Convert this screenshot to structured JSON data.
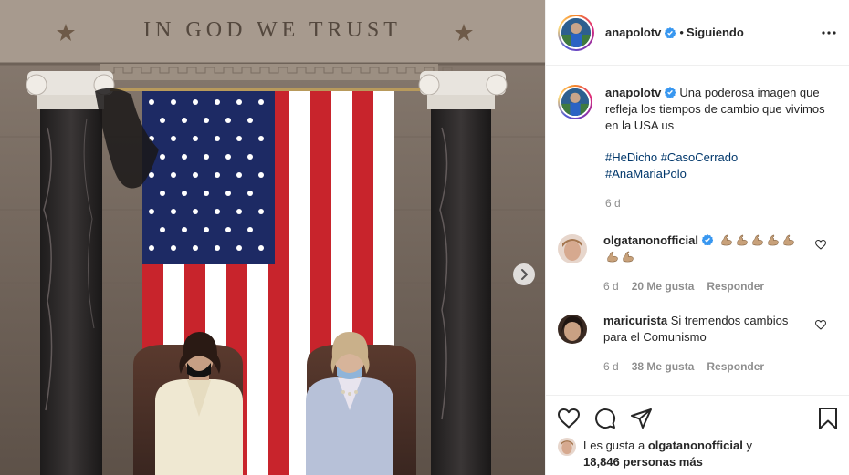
{
  "photo": {
    "inscription": "IN GOD WE TRUST",
    "next_icon": "chevron-right-icon"
  },
  "header": {
    "username": "anapolotv",
    "separator": "•",
    "follow_status": "Siguiendo",
    "more_icon": "more-horizontal-icon"
  },
  "caption": {
    "username": "anapolotv",
    "text": "Una poderosa imagen que refleja los tiempos de cambio que vivimos en la USA us",
    "hashtags_line1": "#HeDicho #CasoCerrado",
    "hashtags_line2": "#AnaMariaPolo",
    "time": "6 d"
  },
  "comments": [
    {
      "username": "olgatanonofficial",
      "verified": true,
      "text": "",
      "emoji": "flexed-biceps",
      "emoji_count": 7,
      "time": "6 d",
      "likes": "20 Me gusta",
      "reply": "Responder"
    },
    {
      "username": "maricurista",
      "verified": false,
      "text": "Si tremendos cambios para el Comunismo",
      "time": "6 d",
      "likes": "38 Me gusta",
      "reply": "Responder"
    }
  ],
  "actions": {
    "like_icon": "heart-icon",
    "comment_icon": "comment-icon",
    "share_icon": "send-icon",
    "save_icon": "bookmark-icon"
  },
  "likes": {
    "prefix": "Les gusta a",
    "user": "olgatanonofficial",
    "connector": "y",
    "others": "18,846 personas más"
  },
  "colors": {
    "link": "#00376b",
    "verified": "#3897f0",
    "muted": "#8e8e8e",
    "text": "#262626"
  }
}
